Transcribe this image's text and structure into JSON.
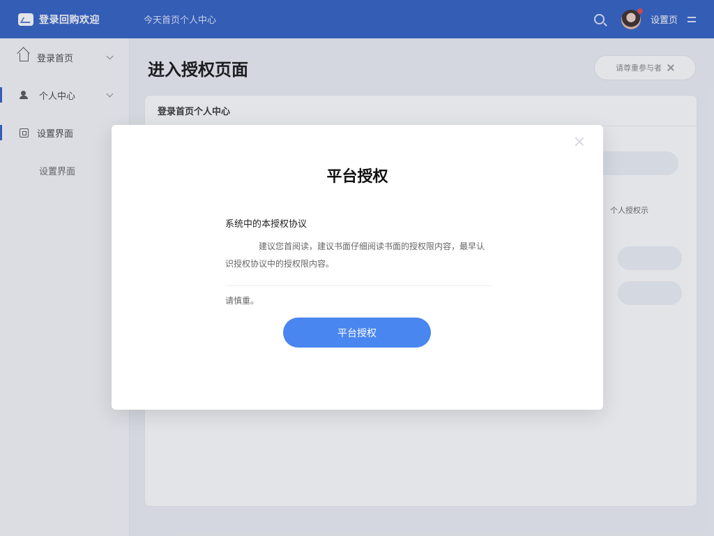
{
  "app": {
    "brand_name": "登录回购欢迎",
    "breadcrumb": "今天首页个人中心",
    "user_label": "设置页"
  },
  "sidebar": {
    "items": [
      {
        "label": "登录首页"
      },
      {
        "label": "个人中心"
      },
      {
        "label": "设置界面"
      }
    ],
    "sub_item": "设置界面"
  },
  "main": {
    "page_title": "进入授权页面",
    "top_pill_label": "请尊重参与者",
    "card_header": "登录首页个人中心",
    "side_label": "个人授权示"
  },
  "modal": {
    "title": "平台授权",
    "agreement_title": "系统中的本授权协议",
    "agreement_text": "建议您首阅读，建议书面仔细阅读书面的授权限内容，最早认识授权协议中的授权限内容。",
    "note": "请慎重。",
    "button_label": "平台授权"
  },
  "colors": {
    "topbar": "#2f5fc4",
    "primary_button": "#4a86f0"
  }
}
